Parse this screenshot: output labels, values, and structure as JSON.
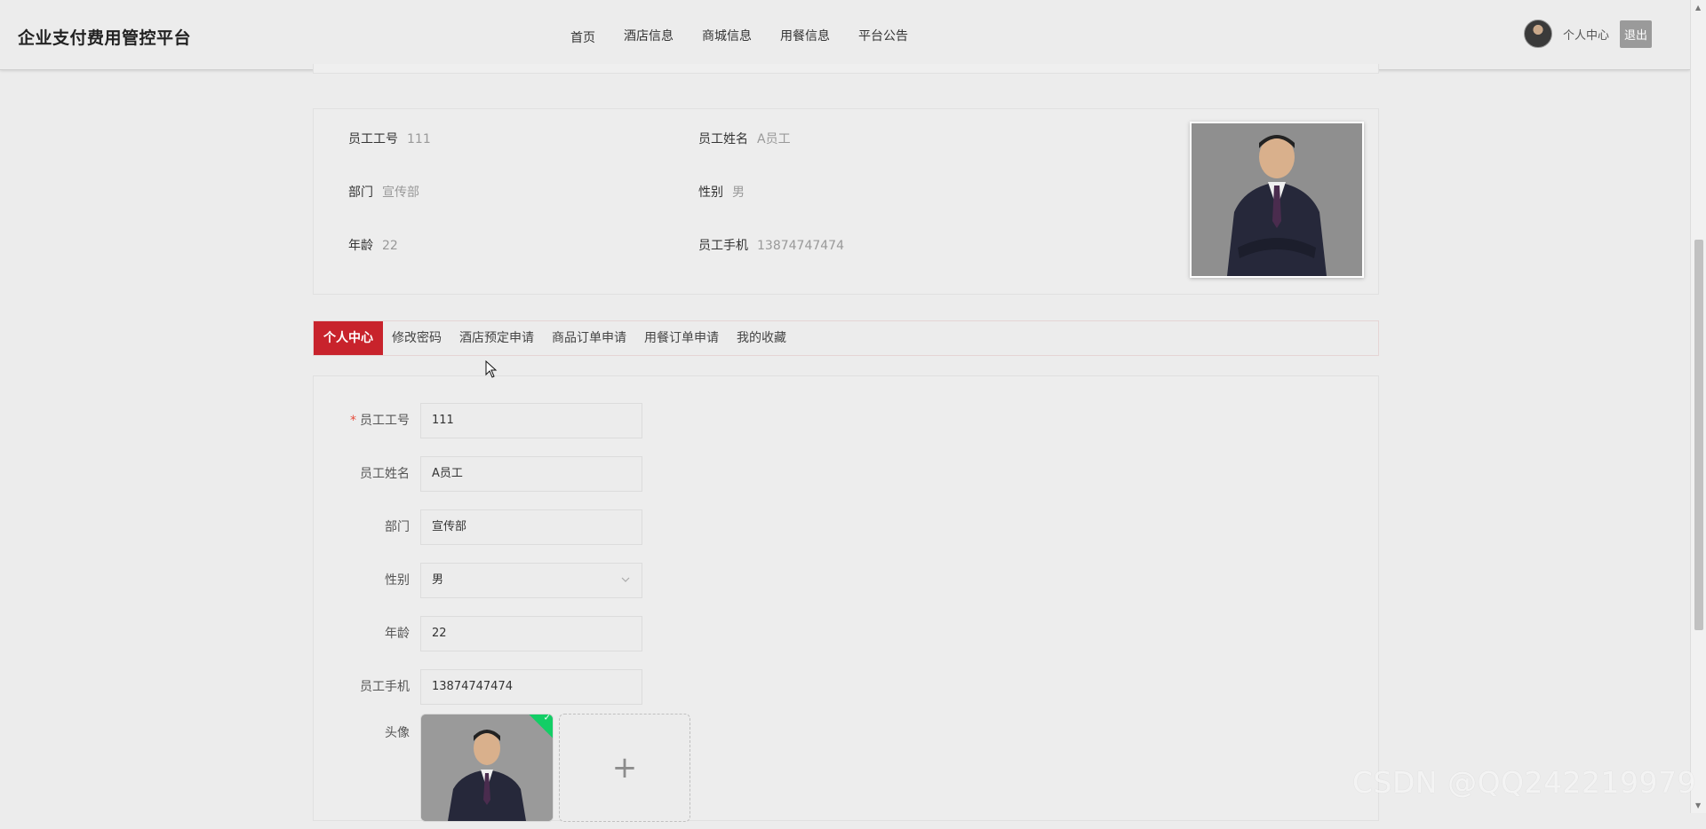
{
  "header": {
    "brand": "企业支付费用管控平台",
    "nav": [
      "首页",
      "酒店信息",
      "商城信息",
      "用餐信息",
      "平台公告"
    ],
    "user_center": "个人中心",
    "logout": "退出"
  },
  "profile": {
    "fields": [
      {
        "label": "员工工号",
        "value": "111"
      },
      {
        "label": "员工姓名",
        "value": "A员工"
      },
      {
        "label": "部门",
        "value": "宣传部"
      },
      {
        "label": "性别",
        "value": "男"
      },
      {
        "label": "年龄",
        "value": "22"
      },
      {
        "label": "员工手机",
        "value": "13874747474"
      }
    ]
  },
  "tabs": [
    "个人中心",
    "修改密码",
    "酒店预定申请",
    "商品订单申请",
    "用餐订单申请",
    "我的收藏"
  ],
  "active_tab": "个人中心",
  "form": {
    "required_mark": "*",
    "fields": [
      {
        "label": "员工工号",
        "value": "111",
        "required": true
      },
      {
        "label": "员工姓名",
        "value": "A员工"
      },
      {
        "label": "部门",
        "value": "宣传部"
      },
      {
        "label": "性别",
        "value": "男",
        "type": "select"
      },
      {
        "label": "年龄",
        "value": "22"
      },
      {
        "label": "员工手机",
        "value": "13874747474"
      }
    ],
    "avatar_label": "头像",
    "upload_plus": "+"
  },
  "watermark": "CSDN @QQ242219979",
  "colors": {
    "accent": "#c8232c",
    "success": "#13ce66"
  },
  "icons": {
    "select_arrow": "chevron-down-icon",
    "upload": "plus-icon",
    "upload_status": "check-icon"
  }
}
